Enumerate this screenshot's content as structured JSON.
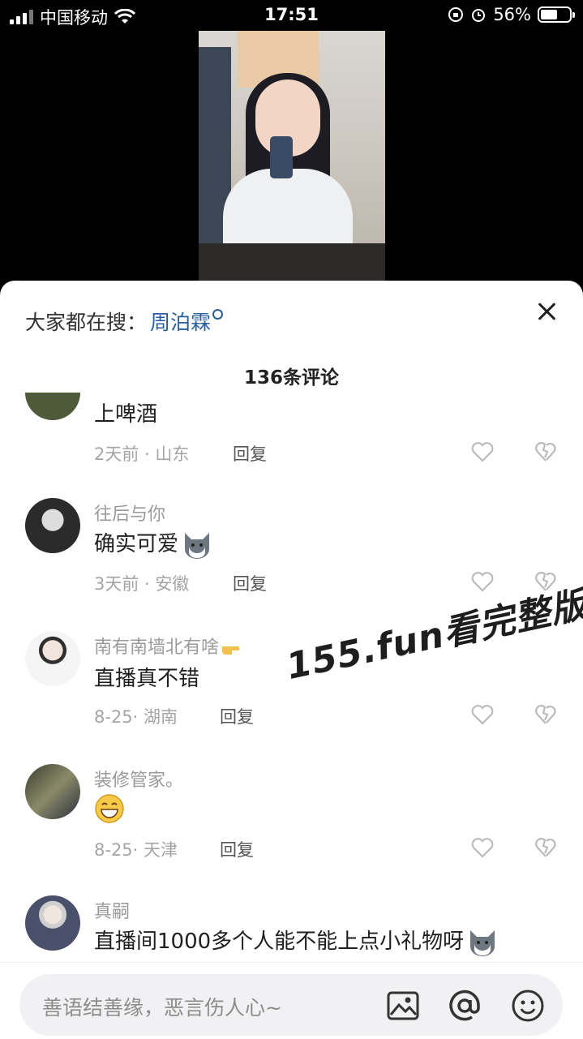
{
  "status_bar": {
    "carrier": "中国移动",
    "time": "17:51",
    "battery": "56%",
    "battery_level": 0.56
  },
  "hot_search": {
    "prefix": "大家都在搜：",
    "term": "周泊霖"
  },
  "comments_header": {
    "count_text": "136条评论"
  },
  "comments": [
    {
      "user": "",
      "text": "上啤酒",
      "date": "2天前",
      "location": "山东",
      "reply": "回复"
    },
    {
      "user": "往后与你",
      "text": "确实可爱",
      "emoji": "husky-emoji",
      "date": "3天前",
      "location": "安徽",
      "reply": "回复"
    },
    {
      "user": "南有南墙北有啥",
      "user_emoji": "pointing-hand-emoji",
      "text": "直播真不错",
      "date": "8-25",
      "location": "湖南",
      "reply": "回复"
    },
    {
      "user": "装修管家。",
      "text": "",
      "emoji": "grin-emoji",
      "date": "8-25",
      "location": "天津",
      "reply": "回复"
    },
    {
      "user": "真嗣",
      "text": "直播间1000多个人能不能上点小礼物呀",
      "emoji": "husky-emoji"
    }
  ],
  "watermark": "155.fun看完整版",
  "input": {
    "placeholder": "善语结善缘，恶言伤人心~"
  },
  "icons": {
    "image": "image-icon",
    "mention": "at-icon",
    "emoji": "smiley-icon"
  },
  "colors": {
    "accent": "#2a5d9c",
    "sheet_bg": "#ffffff",
    "input_bg": "#f1f1f3"
  }
}
